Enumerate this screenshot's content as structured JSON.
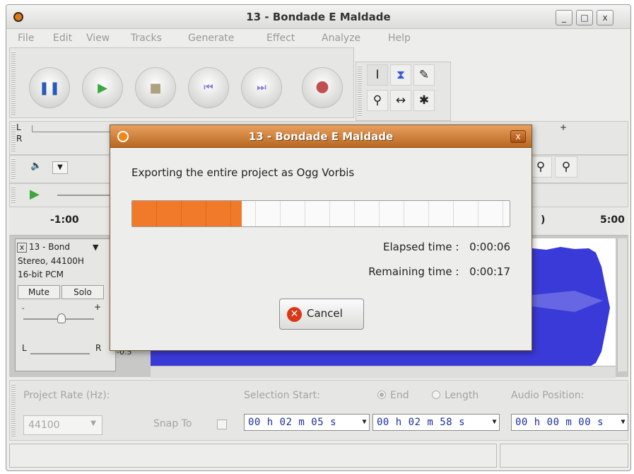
{
  "window": {
    "title": "13 - Bondade E Maldade"
  },
  "window_controls": {
    "minimize": "_",
    "maximize": "□",
    "close": "x"
  },
  "menu": [
    "File",
    "Edit",
    "View",
    "Tracks",
    "Generate",
    "Effect",
    "Analyze",
    "Help"
  ],
  "meter": {
    "left": "L",
    "right": "R",
    "plus": "+"
  },
  "ruler": {
    "start": "-1:00",
    "end_partial": ")",
    "end": "5:00"
  },
  "track": {
    "name": "13 - Bond",
    "info_line1": "Stereo, 44100H",
    "info_line2": "16-bit PCM",
    "mute": "Mute",
    "solo": "Solo",
    "gain_minus": "-",
    "gain_plus": "+",
    "pan_left": "L",
    "pan_right": "R",
    "scale_value": "-0.5"
  },
  "dialog": {
    "title": "13 - Bondade E Maldade",
    "message": "Exporting the entire project as Ogg Vorbis",
    "progress": 0.29,
    "elapsed_label": "Elapsed time :",
    "elapsed_value": "0:00:06",
    "remaining_label": "Remaining time :",
    "remaining_value": "0:00:17",
    "cancel_label": "Cancel",
    "close": "x"
  },
  "selection_bar": {
    "project_rate_label": "Project Rate (Hz):",
    "project_rate_value": "44100",
    "snap_to_label": "Snap To",
    "selection_start_label": "Selection Start:",
    "end_label": "End",
    "length_label": "Length",
    "audio_position_label": "Audio Position:",
    "selection_start_value": "00 h 02 m 05 s",
    "selection_end_value": "00 h 02 m 58 s",
    "audio_position_value": "00 h 00 m 00 s"
  },
  "colors": {
    "accent": "#f07a2a",
    "waveform": "#3a3ad8",
    "dialog_title": "#c07028",
    "timecode_text": "#1b2fa0"
  }
}
